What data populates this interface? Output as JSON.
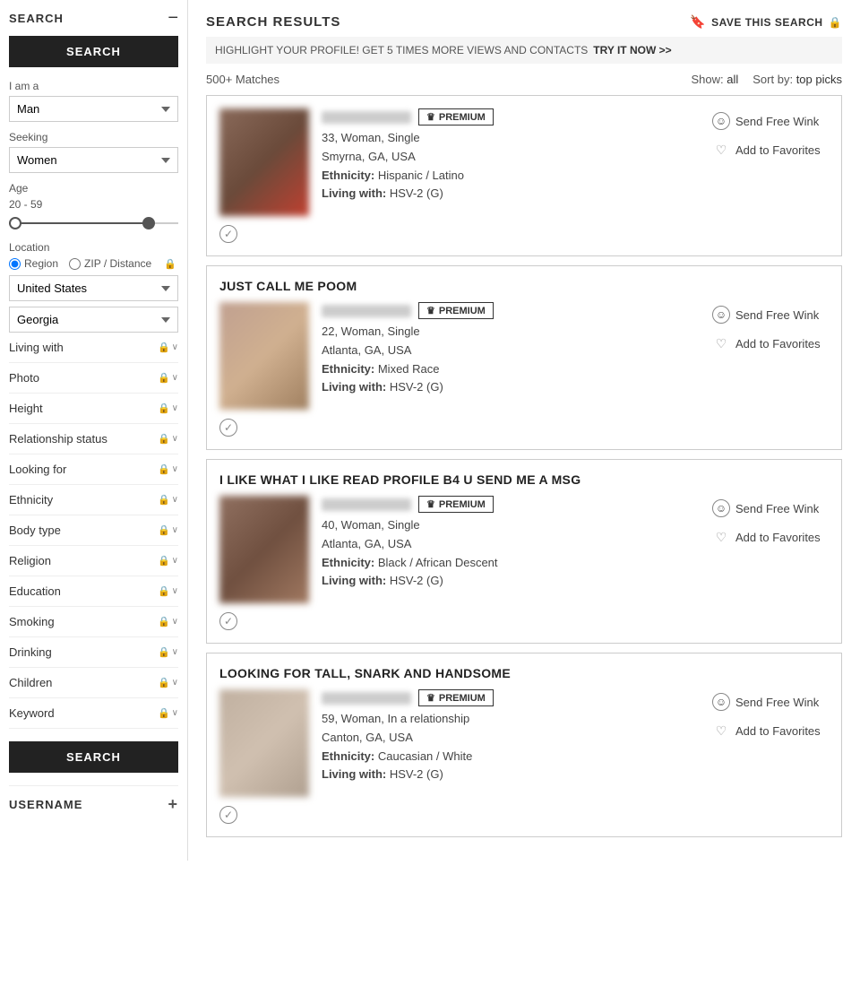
{
  "sidebar": {
    "header_label": "SEARCH",
    "minus_symbol": "−",
    "search_button": "SEARCH",
    "i_am_a_label": "I am a",
    "i_am_a_value": "Man",
    "seeking_label": "Seeking",
    "seeking_value": "Women",
    "age_label": "Age",
    "age_range": "20 - 59",
    "location_label": "Location",
    "location_region_option": "Region",
    "location_zip_option": "ZIP / Distance",
    "country_value": "United States",
    "state_value": "Georgia",
    "filters": [
      {
        "label": "Living with",
        "locked": true
      },
      {
        "label": "Photo",
        "locked": true
      },
      {
        "label": "Height",
        "locked": true
      },
      {
        "label": "Relationship status",
        "locked": true
      },
      {
        "label": "Looking for",
        "locked": true
      },
      {
        "label": "Ethnicity",
        "locked": true
      },
      {
        "label": "Body type",
        "locked": true
      },
      {
        "label": "Religion",
        "locked": true
      },
      {
        "label": "Education",
        "locked": true
      },
      {
        "label": "Smoking",
        "locked": true
      },
      {
        "label": "Drinking",
        "locked": true
      },
      {
        "label": "Children",
        "locked": true
      },
      {
        "label": "Keyword",
        "locked": true
      }
    ],
    "footer_label": "USERNAME",
    "footer_plus": "+"
  },
  "main": {
    "title": "SEARCH RESULTS",
    "save_search_label": "SAVE THIS SEARCH",
    "highlight_text": "HIGHLIGHT YOUR PROFILE! GET 5 TIMES MORE VIEWS AND CONTACTS",
    "try_link": "TRY IT NOW >>",
    "matches_count": "500+ Matches",
    "show_label": "Show:",
    "show_value": "all",
    "sort_label": "Sort by:",
    "sort_value": "top picks",
    "premium_badge": "PREMIUM",
    "send_wink_label": "Send Free Wink",
    "add_favorites_label": "Add to Favorites",
    "profiles": [
      {
        "has_title": false,
        "title": "",
        "age_gender_status": "33, Woman, Single",
        "location": "Smyrna, GA, USA",
        "ethnicity": "Hispanic / Latino",
        "living_with": "HSV-2 (G)",
        "photo_class": "card-photo-1"
      },
      {
        "has_title": true,
        "title": "JUST CALL ME POOM",
        "age_gender_status": "22, Woman, Single",
        "location": "Atlanta, GA, USA",
        "ethnicity": "Mixed Race",
        "living_with": "HSV-2 (G)",
        "photo_class": "card-photo-2"
      },
      {
        "has_title": true,
        "title": "I LIKE WHAT I LIKE READ PROFILE B4 U SEND ME A MSG",
        "age_gender_status": "40, Woman, Single",
        "location": "Atlanta, GA, USA",
        "ethnicity": "Black / African Descent",
        "living_with": "HSV-2 (G)",
        "photo_class": "card-photo-3"
      },
      {
        "has_title": true,
        "title": "LOOKING FOR TALL, SNARK AND HANDSOME",
        "age_gender_status": "59, Woman, In a relationship",
        "location": "Canton, GA, USA",
        "ethnicity": "Caucasian / White",
        "living_with": "HSV-2 (G)",
        "photo_class": "card-photo-4"
      }
    ]
  }
}
